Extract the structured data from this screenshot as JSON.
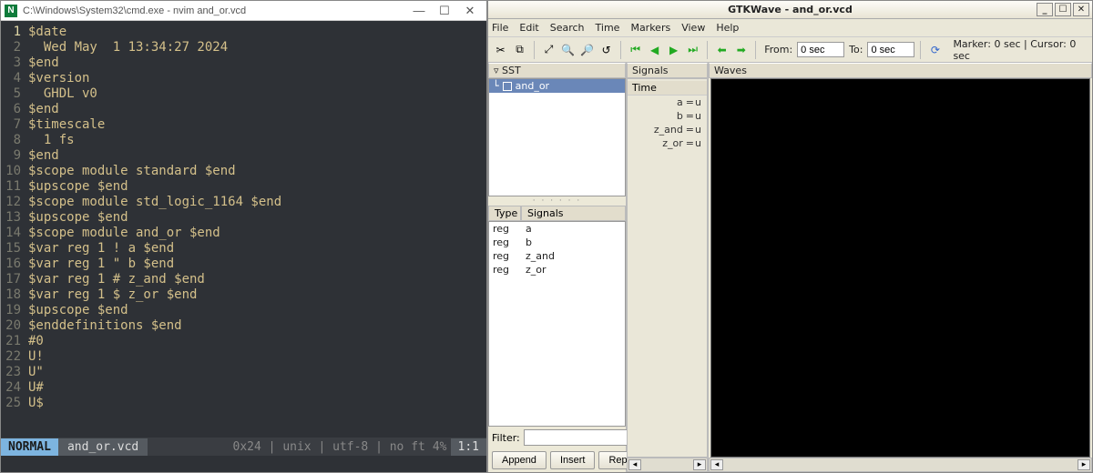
{
  "nvim": {
    "title": "C:\\Windows\\System32\\cmd.exe - nvim  and_or.vcd",
    "lines": [
      "$date",
      "  Wed May  1 13:34:27 2024",
      "$end",
      "$version",
      "  GHDL v0",
      "$end",
      "$timescale",
      "  1 fs",
      "$end",
      "$scope module standard $end",
      "$upscope $end",
      "$scope module std_logic_1164 $end",
      "$upscope $end",
      "$scope module and_or $end",
      "$var reg 1 ! a $end",
      "$var reg 1 \" b $end",
      "$var reg 1 # z_and $end",
      "$var reg 1 $ z_or $end",
      "$upscope $end",
      "$enddefinitions $end",
      "#0",
      "U!",
      "U\"",
      "U#",
      "U$"
    ],
    "status": {
      "mode": "NORMAL",
      "file": "and_or.vcd",
      "info": "0x24 | unix | utf-8 | no ft",
      "percent": "4%",
      "pos": "1:1"
    }
  },
  "gtk": {
    "title": "GTKWave - and_or.vcd",
    "menus": [
      "File",
      "Edit",
      "Search",
      "Time",
      "Markers",
      "View",
      "Help"
    ],
    "from_label": "From:",
    "from_value": "0 sec",
    "to_label": "To:",
    "to_value": "0 sec",
    "marker_status": "Marker: 0 sec | Cursor: 0 sec",
    "sst_label": "SST",
    "sst_root": "and_or",
    "type_col": "Type",
    "signals_col": "Signals",
    "signals": [
      {
        "type": "reg",
        "name": "a"
      },
      {
        "type": "reg",
        "name": "b"
      },
      {
        "type": "reg",
        "name": "z_and"
      },
      {
        "type": "reg",
        "name": "z_or"
      }
    ],
    "filter_label": "Filter:",
    "buttons": {
      "append": "Append",
      "insert": "Insert",
      "replace": "Replace"
    },
    "mid_header": "Signals",
    "time_label": "Time",
    "sigvals": [
      {
        "name": "a",
        "val": "u"
      },
      {
        "name": "b",
        "val": "u"
      },
      {
        "name": "z_and",
        "val": "u"
      },
      {
        "name": "z_or",
        "val": "u"
      }
    ],
    "waves_label": "Waves"
  }
}
